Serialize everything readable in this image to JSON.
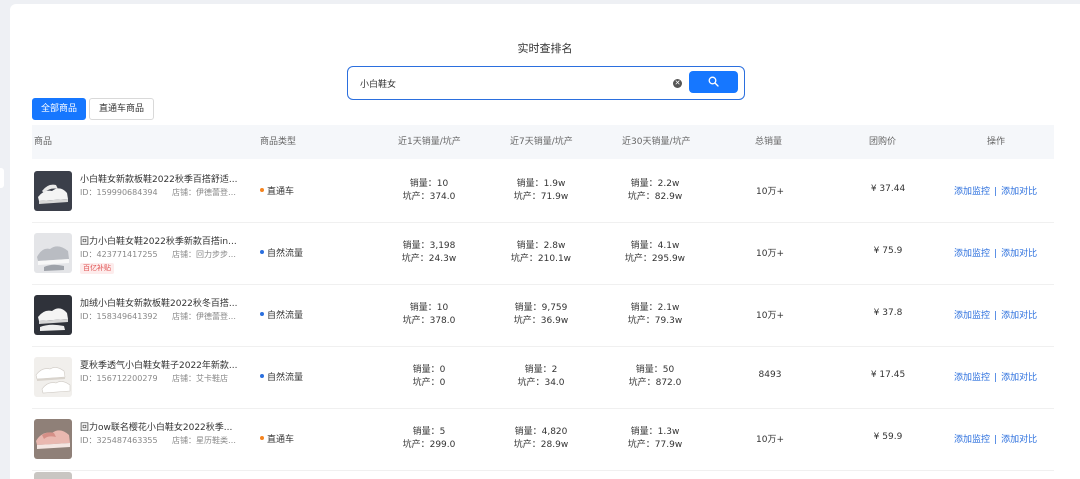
{
  "page": {
    "title": "实时查排名"
  },
  "search": {
    "value": "小白鞋女",
    "clear_icon": "✕"
  },
  "tabs": [
    {
      "label": "全部商品",
      "active": true
    },
    {
      "label": "直通车商品",
      "active": false
    }
  ],
  "table": {
    "headers": {
      "product": "商品",
      "type": "商品类型",
      "d1": "近1天销量/坑产",
      "d7": "近7天销量/坑产",
      "d30": "近30天销量/坑产",
      "total": "总销量",
      "price": "团购价",
      "ops": "操作"
    },
    "rows": [
      {
        "name": "小白鞋女新款板鞋2022秋季百搭舒适...",
        "id": "ID：159990684394",
        "shop": "店铺：伊德蕾登官...",
        "tag": "",
        "type": "直通车",
        "type_color": "orange",
        "d1": {
          "sales": "销量：10",
          "output": "坑产：374.0"
        },
        "d7": {
          "sales": "销量：1.9w",
          "output": "坑产：71.9w"
        },
        "d30": {
          "sales": "销量：2.2w",
          "output": "坑产：82.9w"
        },
        "total": "10万+",
        "price": "¥ 37.44",
        "thumb": "black-sneaker"
      },
      {
        "name": "回力小白鞋女鞋2022秋季新款百搭in...",
        "id": "ID：423771417255",
        "shop": "店铺：回力步步佳...",
        "tag": "百亿补贴",
        "type": "自然流量",
        "type_color": "blue",
        "d1": {
          "sales": "销量：3,198",
          "output": "坑产：24.3w"
        },
        "d7": {
          "sales": "销量：2.8w",
          "output": "坑产：210.1w"
        },
        "d30": {
          "sales": "销量：4.1w",
          "output": "坑产：295.9w"
        },
        "total": "10万+",
        "price": "¥ 75.9",
        "thumb": "grey-sneaker"
      },
      {
        "name": "加绒小白鞋女新款板鞋2022秋冬百搭...",
        "id": "ID：158349641392",
        "shop": "店铺：伊德蕾登官...",
        "tag": "",
        "type": "自然流量",
        "type_color": "blue",
        "d1": {
          "sales": "销量：10",
          "output": "坑产：378.0"
        },
        "d7": {
          "sales": "销量：9,759",
          "output": "坑产：36.9w"
        },
        "d30": {
          "sales": "销量：2.1w",
          "output": "坑产：79.3w"
        },
        "total": "10万+",
        "price": "¥ 37.8",
        "thumb": "black-sneaker"
      },
      {
        "name": "夏秋季透气小白鞋女鞋子2022年新款...",
        "id": "ID：156712200279",
        "shop": "店铺：艾卡鞋店",
        "tag": "",
        "type": "自然流量",
        "type_color": "blue",
        "d1": {
          "sales": "销量：0",
          "output": "坑产：0"
        },
        "d7": {
          "sales": "销量：2",
          "output": "坑产：34.0"
        },
        "d30": {
          "sales": "销量：50",
          "output": "坑产：872.0"
        },
        "total": "8493",
        "price": "¥ 17.45",
        "thumb": "white-sneaker"
      },
      {
        "name": "回力ow联名樱花小白鞋女2022秋季...",
        "id": "ID：325487463355",
        "shop": "店铺：星历鞋类专...",
        "tag": "",
        "type": "直通车",
        "type_color": "orange",
        "d1": {
          "sales": "销量：5",
          "output": "坑产：299.0"
        },
        "d7": {
          "sales": "销量：4,820",
          "output": "坑产：28.9w"
        },
        "d30": {
          "sales": "销量：1.3w",
          "output": "坑产：77.9w"
        },
        "total": "10万+",
        "price": "¥ 59.9",
        "thumb": "pink-sneaker"
      }
    ],
    "actions": {
      "monitor": "添加监控",
      "separator": "|",
      "compare": "添加对比"
    }
  }
}
